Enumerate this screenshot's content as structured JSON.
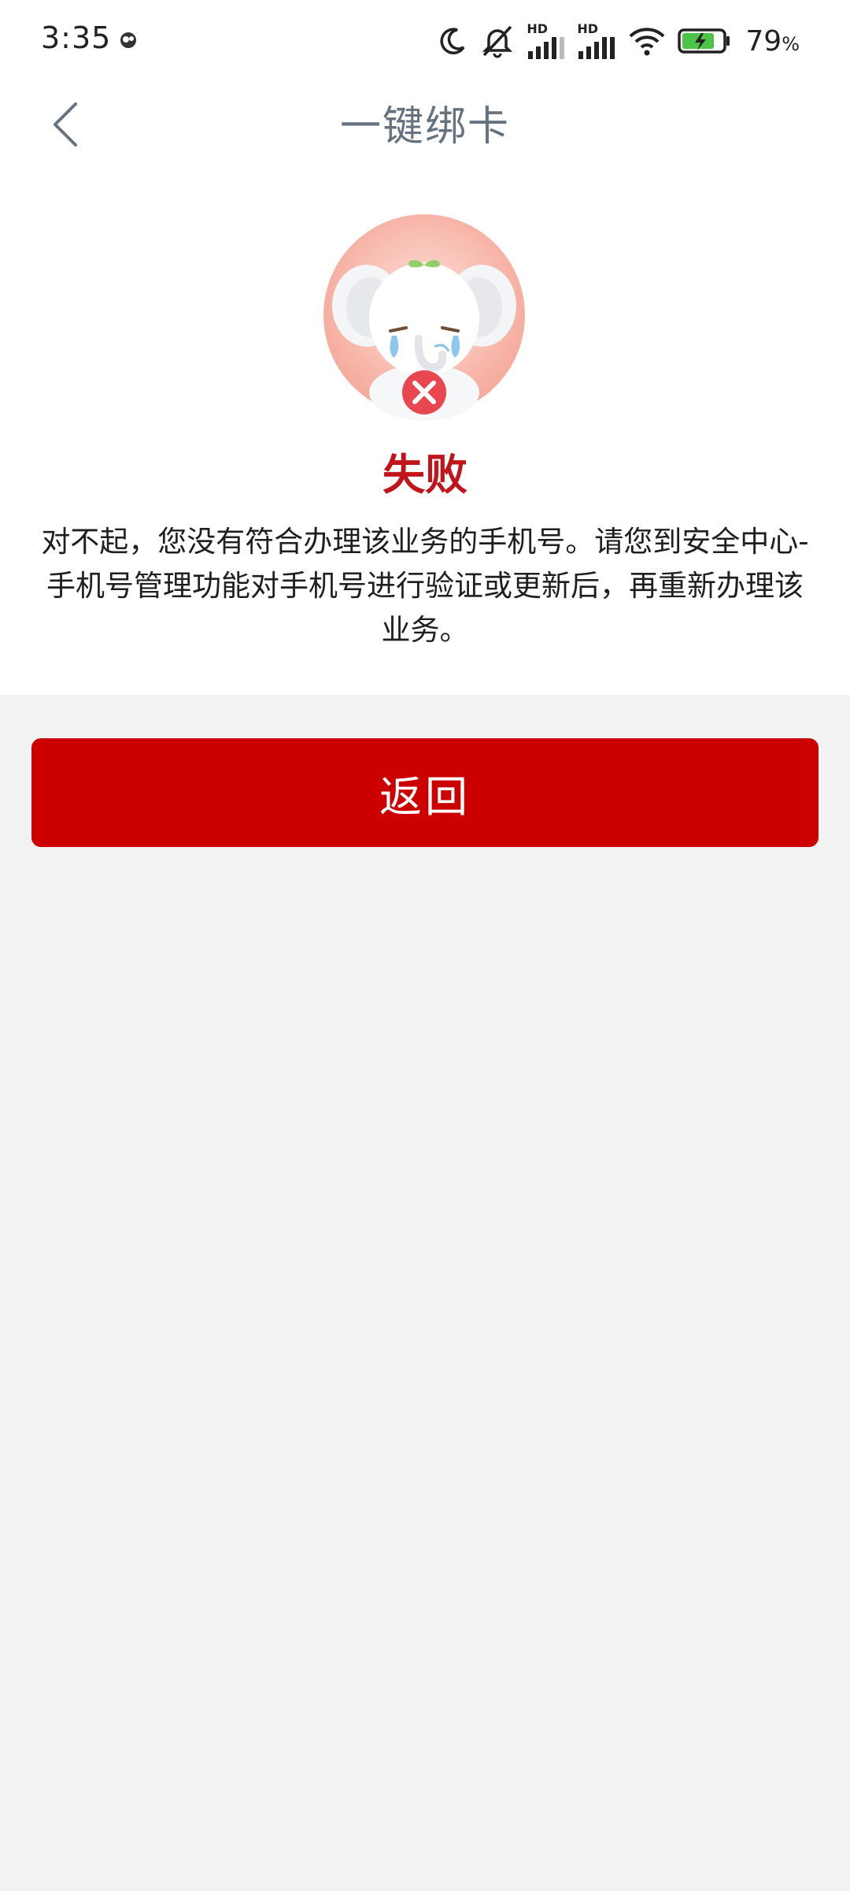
{
  "status_bar": {
    "time": "3:35",
    "battery_percent": "79",
    "battery_unit": "%",
    "network_labels": [
      "HD",
      "HD"
    ]
  },
  "header": {
    "title": "一键绑卡"
  },
  "result": {
    "title": "失败",
    "message": "对不起，您没有符合办理该业务的手机号。请您到安全中心-手机号管理功能对手机号进行验证或更新后，再重新办理该业务。"
  },
  "actions": {
    "return_label": "返回"
  },
  "colors": {
    "accent_red": "#cc0000",
    "title_red": "#c0161b",
    "background": "#f2f2f2"
  }
}
